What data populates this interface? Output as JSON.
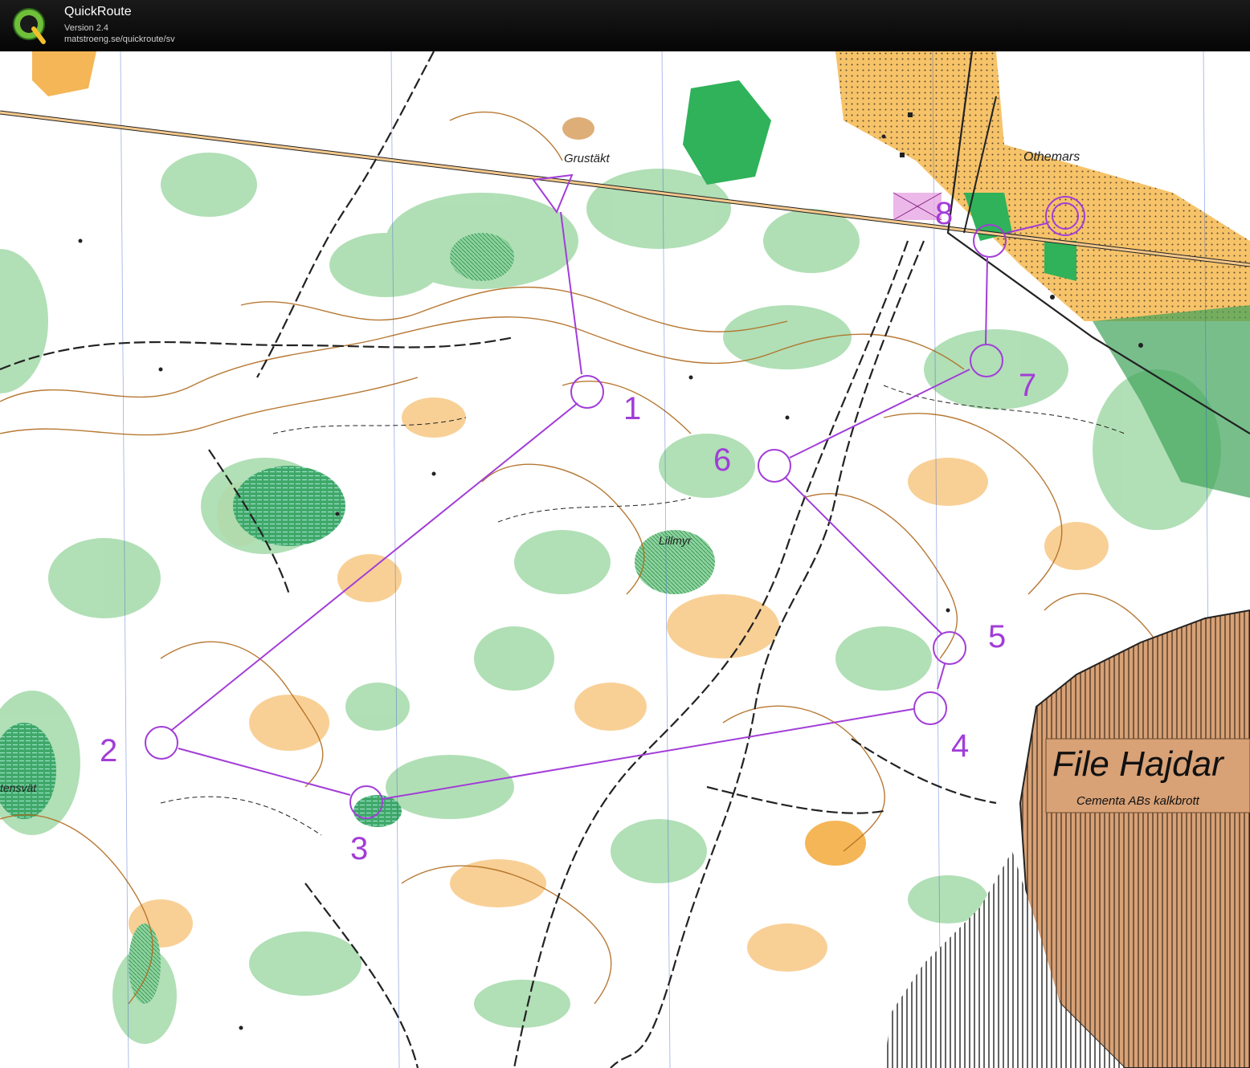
{
  "app": {
    "title": "QuickRoute",
    "version": "Version 2.4",
    "url": "matstroeng.se/quickroute/sv",
    "logo_letter": "Q"
  },
  "map": {
    "place_labels": {
      "grustakt": "Grustäkt",
      "othemars": "Othemars",
      "lillmyr": "Lillmyr",
      "tensvat": "tensvät"
    },
    "quarry": {
      "name": "File Hajdar",
      "subtitle": "Cementa ABs kalkbrott"
    },
    "course": {
      "color": "#a23dd8",
      "controls": [
        {
          "id": "start",
          "label": ""
        },
        {
          "id": "1",
          "label": "1"
        },
        {
          "id": "2",
          "label": "2"
        },
        {
          "id": "3",
          "label": "3"
        },
        {
          "id": "4",
          "label": "4"
        },
        {
          "id": "5",
          "label": "5"
        },
        {
          "id": "6",
          "label": "6"
        },
        {
          "id": "7",
          "label": "7"
        },
        {
          "id": "8",
          "label": "8"
        },
        {
          "id": "finish",
          "label": ""
        }
      ]
    },
    "colors": {
      "vegetation": "#8fd39e",
      "dense_vegetation": "#2fb25a",
      "open_land": "#f4b55e",
      "contour": "#b06a1e",
      "quarry": "#d79d6d",
      "track": "#222222"
    }
  }
}
